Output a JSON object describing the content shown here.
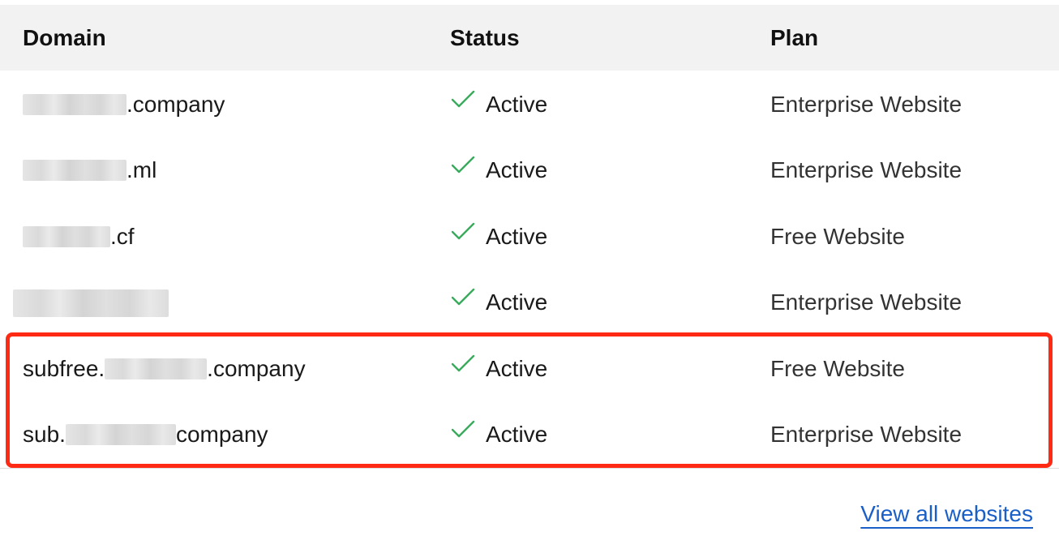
{
  "table": {
    "headers": {
      "domain": "Domain",
      "status": "Status",
      "plan": "Plan"
    },
    "rows": [
      {
        "domain_prefix": "",
        "domain_suffix": ".company",
        "status": "Active",
        "plan": "Enterprise Website"
      },
      {
        "domain_prefix": "",
        "domain_suffix": ".ml",
        "status": "Active",
        "plan": "Enterprise Website"
      },
      {
        "domain_prefix": "",
        "domain_suffix": ".cf",
        "status": "Active",
        "plan": "Free Website"
      },
      {
        "domain_prefix": "",
        "domain_suffix": "",
        "status": "Active",
        "plan": "Enterprise Website"
      },
      {
        "domain_prefix": "subfree.",
        "domain_suffix": ".company",
        "status": "Active",
        "plan": "Free Website"
      },
      {
        "domain_prefix": "sub.",
        "domain_suffix": "company",
        "status": "Active",
        "plan": "Enterprise Website"
      }
    ]
  },
  "footer": {
    "view_all_label": "View all websites"
  },
  "colors": {
    "check": "#3aaa5c",
    "highlight": "#ff2a14",
    "link": "#1a5fc7",
    "header_bg": "#f2f2f2"
  },
  "icons": {
    "status_active": "check-icon"
  }
}
